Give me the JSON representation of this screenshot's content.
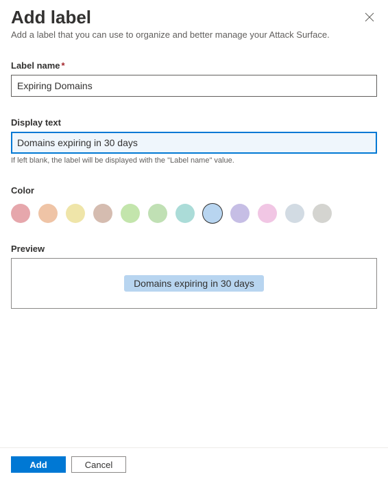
{
  "header": {
    "title": "Add label",
    "subtitle": "Add a label that you can use to organize and better manage your Attack Surface."
  },
  "labelName": {
    "label": "Label name",
    "value": "Expiring Domains"
  },
  "displayText": {
    "label": "Display text",
    "value": "Domains expiring in 30 days",
    "hint": "If left blank, the label will be displayed with the \"Label name\" value."
  },
  "color": {
    "label": "Color",
    "swatches": [
      {
        "hex": "#e6a7ac",
        "selected": false
      },
      {
        "hex": "#efc4a6",
        "selected": false
      },
      {
        "hex": "#efe5a9",
        "selected": false
      },
      {
        "hex": "#d5bcb0",
        "selected": false
      },
      {
        "hex": "#c3e5ac",
        "selected": false
      },
      {
        "hex": "#c0e0b4",
        "selected": false
      },
      {
        "hex": "#abdcd8",
        "selected": false
      },
      {
        "hex": "#b8d5f0",
        "selected": true
      },
      {
        "hex": "#c6bee5",
        "selected": false
      },
      {
        "hex": "#f1c6e4",
        "selected": false
      },
      {
        "hex": "#d2dbe3",
        "selected": false
      },
      {
        "hex": "#d4d4d0",
        "selected": false
      }
    ]
  },
  "preview": {
    "label": "Preview",
    "chipText": "Domains expiring in 30 days",
    "chipColor": "#b8d5f0"
  },
  "footer": {
    "primary": "Add",
    "secondary": "Cancel"
  }
}
